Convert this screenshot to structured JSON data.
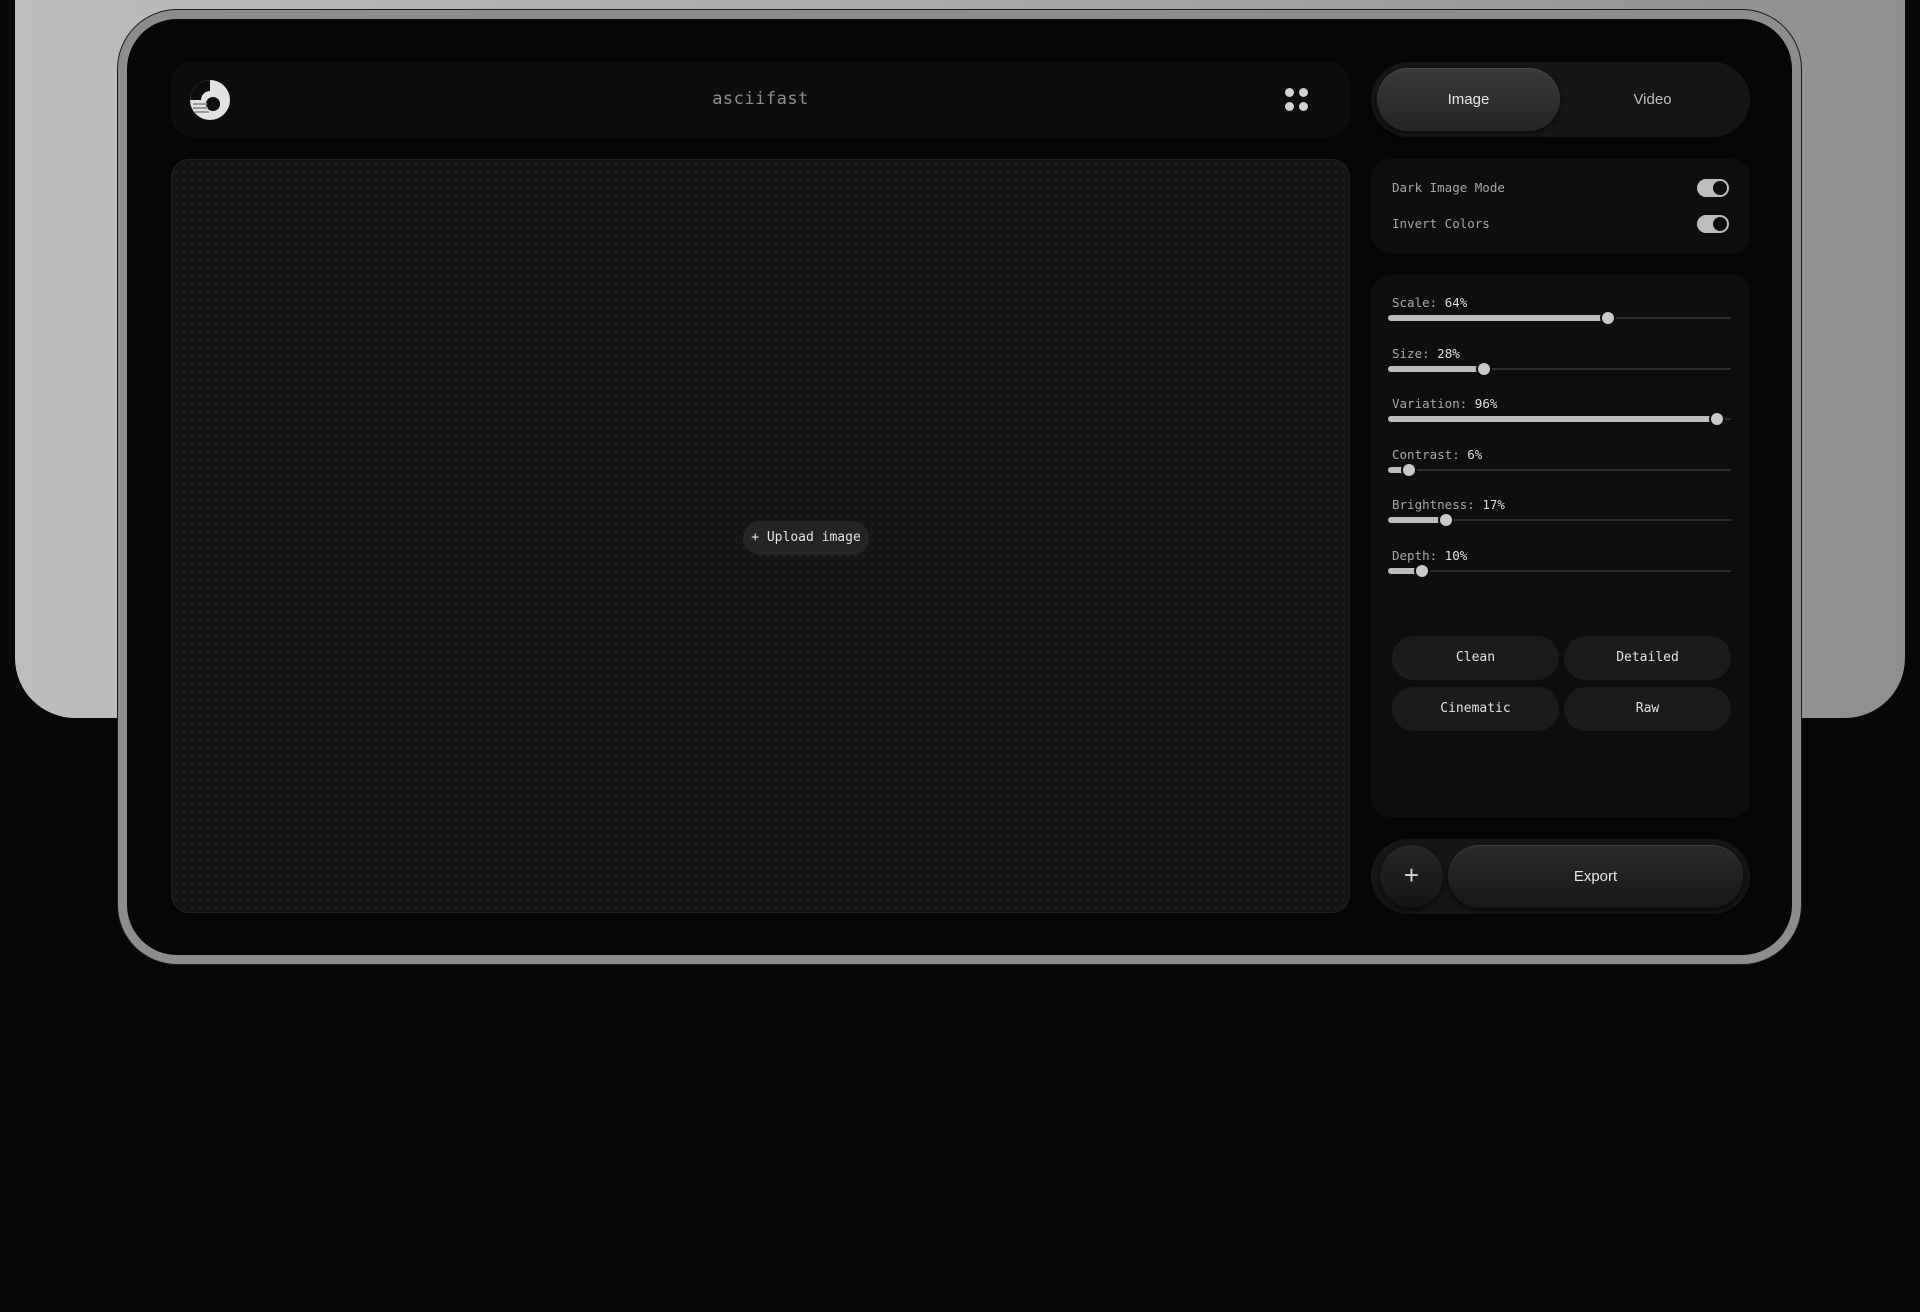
{
  "app": {
    "title": "asciifast"
  },
  "canvas": {
    "upload_label": "+ Upload image"
  },
  "mode": {
    "tabs": [
      "Image",
      "Video"
    ],
    "active": "Image"
  },
  "options": [
    {
      "label": "Dark Image Mode",
      "enabled": true
    },
    {
      "label": "Invert Colors",
      "enabled": true
    }
  ],
  "sliders": [
    {
      "label": "Scale:",
      "display": "64%",
      "value": 64
    },
    {
      "label": "Size:",
      "display": "28%",
      "value": 28
    },
    {
      "label": "Variation:",
      "display": "96%",
      "value": 96
    },
    {
      "label": "Contrast:",
      "display": "6%",
      "value": 6
    },
    {
      "label": "Brightness:",
      "display": "17%",
      "value": 17
    },
    {
      "label": "Depth:",
      "display": "10%",
      "value": 10
    }
  ],
  "presets": [
    "Clean",
    "Detailed",
    "Cinematic",
    "Raw"
  ],
  "actions": {
    "add_label": "+",
    "export_label": "Export"
  },
  "icons": {
    "logo": "logo-icon",
    "grid": "grid-icon"
  },
  "colors": {
    "background": "#070707",
    "panel": "#0e0e0e",
    "accent": "#bdbdbd"
  }
}
